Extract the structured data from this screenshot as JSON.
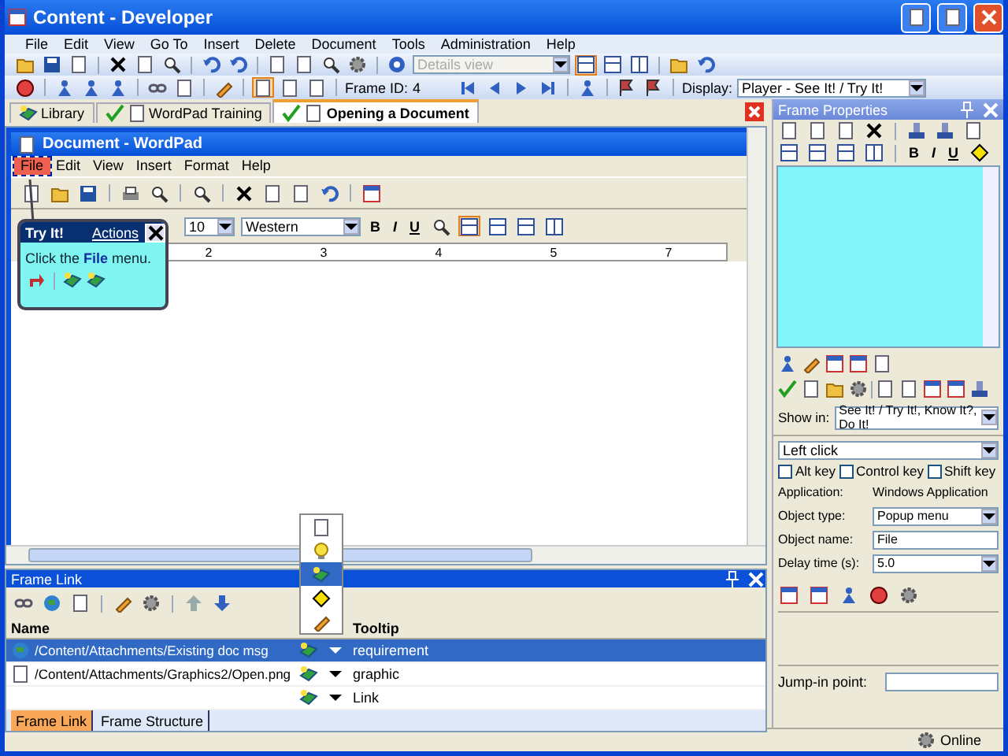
{
  "window": {
    "title": "Content - Developer"
  },
  "menu": [
    "File",
    "Edit",
    "View",
    "Go To",
    "Insert",
    "Delete",
    "Document",
    "Tools",
    "Administration",
    "Help"
  ],
  "toolbar": {
    "view_select": {
      "value": "Details view",
      "disabled": true
    },
    "frame_id_label": "Frame ID:",
    "frame_id": "4",
    "display_label": "Display:",
    "display_value": "Player - See It! / Try It!"
  },
  "tabs": [
    {
      "label": "Library",
      "selected": false,
      "checked": false
    },
    {
      "label": "WordPad Training",
      "selected": false,
      "checked": true
    },
    {
      "label": "Opening a Document",
      "selected": true,
      "checked": true
    }
  ],
  "document_window": {
    "title": "Document - WordPad",
    "menu": [
      {
        "label": "File",
        "highlighted": true
      },
      {
        "label": "Edit",
        "highlighted": false
      },
      {
        "label": "View",
        "highlighted": false
      },
      {
        "label": "Insert",
        "highlighted": false
      },
      {
        "label": "Format",
        "highlighted": false
      },
      {
        "label": "Help",
        "highlighted": false
      }
    ],
    "font_size": "10",
    "script": "Western",
    "format_buttons": [
      "B",
      "I",
      "U"
    ],
    "ruler_labels": [
      "2",
      "3",
      "4",
      "5",
      "7"
    ]
  },
  "bubble": {
    "title": "Try It!",
    "link": "Actions",
    "text": "Click the **File** menu."
  },
  "frame_link": {
    "title": "Frame Link",
    "columns": [
      "Name",
      "Tooltip"
    ],
    "rows": [
      {
        "name": "/Content/Attachments/Existing doc msg",
        "tooltip": "requirement",
        "selected": true
      },
      {
        "name": "/Content/Attachments/Graphics2/Open.png",
        "tooltip": "graphic",
        "selected": false
      },
      {
        "name": "",
        "tooltip": "Link",
        "selected": false
      }
    ],
    "icon_menu": [
      {
        "selected": false
      },
      {
        "selected": false
      },
      {
        "selected": true
      },
      {
        "selected": false
      },
      {
        "selected": false
      }
    ],
    "tabs": [
      {
        "label": "Frame Link",
        "selected": true
      },
      {
        "label": "Frame Structure",
        "selected": false
      }
    ]
  },
  "properties": {
    "title": "Frame Properties",
    "format_buttons": [
      "B",
      "I",
      "U"
    ],
    "show_in_label": "Show in:",
    "show_in": "See It! / Try It!, Know It?, Do It!",
    "action": "Left click",
    "keys": [
      {
        "label": "Alt key",
        "checked": false
      },
      {
        "label": "Control key",
        "checked": false
      },
      {
        "label": "Shift key",
        "checked": false
      }
    ],
    "fields": [
      {
        "label": "Application:",
        "value": "Windows Application",
        "kind": "text"
      },
      {
        "label": "Object type:",
        "value": "Popup menu",
        "kind": "select"
      },
      {
        "label": "Object name:",
        "value": "File",
        "kind": "input"
      },
      {
        "label": "Delay time (s):",
        "value": "5.0",
        "kind": "select"
      }
    ],
    "jump_in_label": "Jump-in point:"
  },
  "status_bar": {
    "text": "Online"
  }
}
